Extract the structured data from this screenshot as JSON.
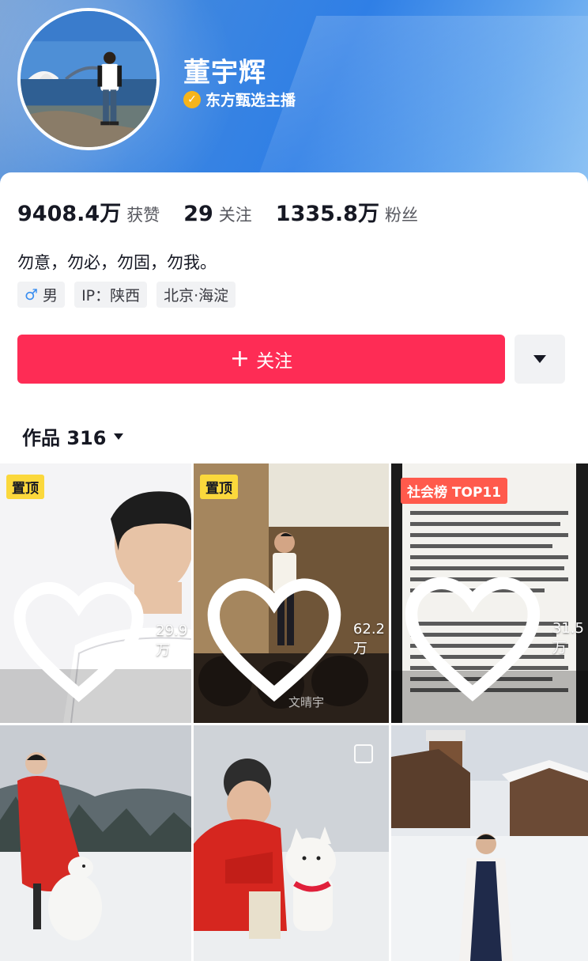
{
  "profile": {
    "name": "董宇辉",
    "verification": "东方甄选主播"
  },
  "stats": {
    "likes_value": "9408.4万",
    "likes_label": "获赞",
    "following_value": "29",
    "following_label": "关注",
    "followers_value": "1335.8万",
    "followers_label": "粉丝"
  },
  "bio": "勿意，勿必，勿固，勿我。",
  "tags": {
    "gender_icon": "♂",
    "gender": "男",
    "ip": "IP：陕西",
    "location": "北京·海淀"
  },
  "follow_button": {
    "icon": "+",
    "label": "关注"
  },
  "works": {
    "label": "作品 316"
  },
  "videos": [
    {
      "badge": "置顶",
      "likes": "29.9万"
    },
    {
      "badge": "置顶",
      "likes": "62.2万",
      "watermark": "文晴宇"
    },
    {
      "badge": "社会榜 TOP11",
      "likes": "31.5万"
    },
    {
      "badge": "",
      "likes": ""
    },
    {
      "badge": "",
      "likes": ""
    },
    {
      "badge": "",
      "likes": ""
    }
  ],
  "colors": {
    "accent": "#fe2c55",
    "pin_badge": "#fbd83c",
    "rank_badge": "#ff5a4c",
    "verify_badge": "#f6b41a"
  }
}
